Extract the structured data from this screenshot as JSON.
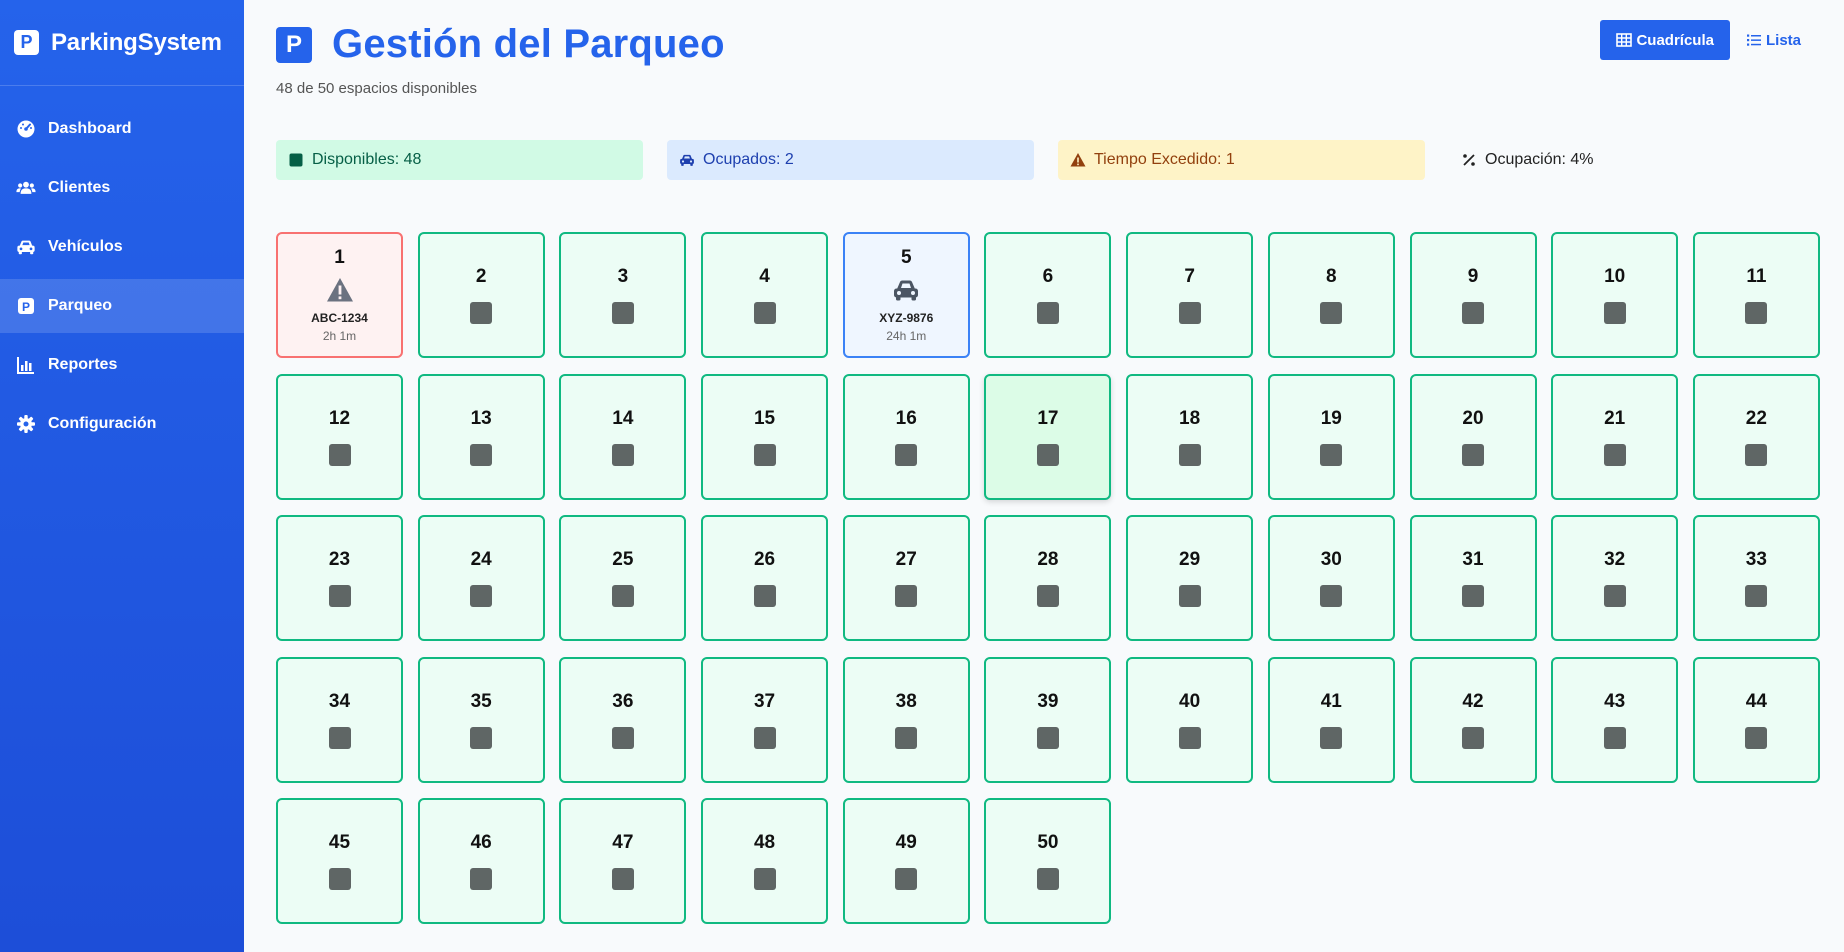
{
  "app": {
    "name": "ParkingSystem",
    "logo_letter": "P"
  },
  "sidebar": {
    "items": [
      {
        "label": "Dashboard",
        "icon": "gauge-icon"
      },
      {
        "label": "Clientes",
        "icon": "users-icon"
      },
      {
        "label": "Vehículos",
        "icon": "car-icon"
      },
      {
        "label": "Parqueo",
        "icon": "parking-icon",
        "active": true
      },
      {
        "label": "Reportes",
        "icon": "chart-icon"
      },
      {
        "label": "Configuración",
        "icon": "gear-icon"
      }
    ]
  },
  "header": {
    "title": "Gestión del Parqueo",
    "logo_letter": "P",
    "subtitle": "48 de 50 espacios disponibles"
  },
  "view_toggle": {
    "grid_label": "Cuadrícula",
    "list_label": "Lista"
  },
  "stats": {
    "available": "Disponibles: 48",
    "occupied": "Ocupados: 2",
    "exceeded": "Tiempo Excedido: 1",
    "occupancy": "Ocupación: 4%"
  },
  "colors": {
    "accent": "#2563eb",
    "available_border": "#10b981",
    "exceeded_border": "#f87171",
    "occupied_border": "#3b82f6"
  },
  "spots": [
    {
      "number": "1",
      "status": "exceeded",
      "plate": "ABC-1234",
      "time": "2h 1m"
    },
    {
      "number": "2",
      "status": "available"
    },
    {
      "number": "3",
      "status": "available"
    },
    {
      "number": "4",
      "status": "available"
    },
    {
      "number": "5",
      "status": "occupied",
      "plate": "XYZ-9876",
      "time": "24h 1m"
    },
    {
      "number": "6",
      "status": "available"
    },
    {
      "number": "7",
      "status": "available"
    },
    {
      "number": "8",
      "status": "available"
    },
    {
      "number": "9",
      "status": "available"
    },
    {
      "number": "10",
      "status": "available"
    },
    {
      "number": "11",
      "status": "available"
    },
    {
      "number": "12",
      "status": "available"
    },
    {
      "number": "13",
      "status": "available"
    },
    {
      "number": "14",
      "status": "available"
    },
    {
      "number": "15",
      "status": "available"
    },
    {
      "number": "16",
      "status": "available"
    },
    {
      "number": "17",
      "status": "available",
      "hover": true
    },
    {
      "number": "18",
      "status": "available"
    },
    {
      "number": "19",
      "status": "available"
    },
    {
      "number": "20",
      "status": "available"
    },
    {
      "number": "21",
      "status": "available"
    },
    {
      "number": "22",
      "status": "available"
    },
    {
      "number": "23",
      "status": "available"
    },
    {
      "number": "24",
      "status": "available"
    },
    {
      "number": "25",
      "status": "available"
    },
    {
      "number": "26",
      "status": "available"
    },
    {
      "number": "27",
      "status": "available"
    },
    {
      "number": "28",
      "status": "available"
    },
    {
      "number": "29",
      "status": "available"
    },
    {
      "number": "30",
      "status": "available"
    },
    {
      "number": "31",
      "status": "available"
    },
    {
      "number": "32",
      "status": "available"
    },
    {
      "number": "33",
      "status": "available"
    },
    {
      "number": "34",
      "status": "available"
    },
    {
      "number": "35",
      "status": "available"
    },
    {
      "number": "36",
      "status": "available"
    },
    {
      "number": "37",
      "status": "available"
    },
    {
      "number": "38",
      "status": "available"
    },
    {
      "number": "39",
      "status": "available"
    },
    {
      "number": "40",
      "status": "available"
    },
    {
      "number": "41",
      "status": "available"
    },
    {
      "number": "42",
      "status": "available"
    },
    {
      "number": "43",
      "status": "available"
    },
    {
      "number": "44",
      "status": "available"
    },
    {
      "number": "45",
      "status": "available"
    },
    {
      "number": "46",
      "status": "available"
    },
    {
      "number": "47",
      "status": "available"
    },
    {
      "number": "48",
      "status": "available"
    },
    {
      "number": "49",
      "status": "available"
    },
    {
      "number": "50",
      "status": "available"
    }
  ]
}
